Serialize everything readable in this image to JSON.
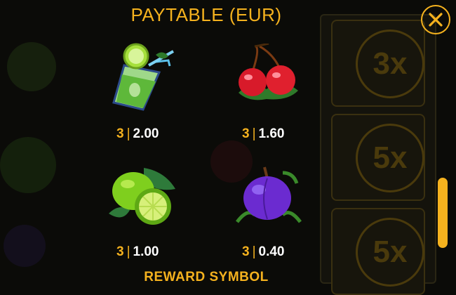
{
  "title": "PAYTABLE  (EUR)",
  "close_icon": "close-icon",
  "symbols": [
    {
      "name": "mojito",
      "count": "3",
      "sep": "|",
      "value": "2.00"
    },
    {
      "name": "cherries",
      "count": "3",
      "sep": "|",
      "value": "1.60"
    },
    {
      "name": "limes",
      "count": "3",
      "sep": "|",
      "value": "1.00"
    },
    {
      "name": "plum",
      "count": "3",
      "sep": "|",
      "value": "0.40"
    }
  ],
  "reward_heading": "REWARD SYMBOL",
  "background_multipliers": [
    "3x",
    "5x",
    "5x"
  ],
  "colors": {
    "accent": "#f5b21e",
    "text": "#ffffff",
    "background": "#0b0b08"
  }
}
